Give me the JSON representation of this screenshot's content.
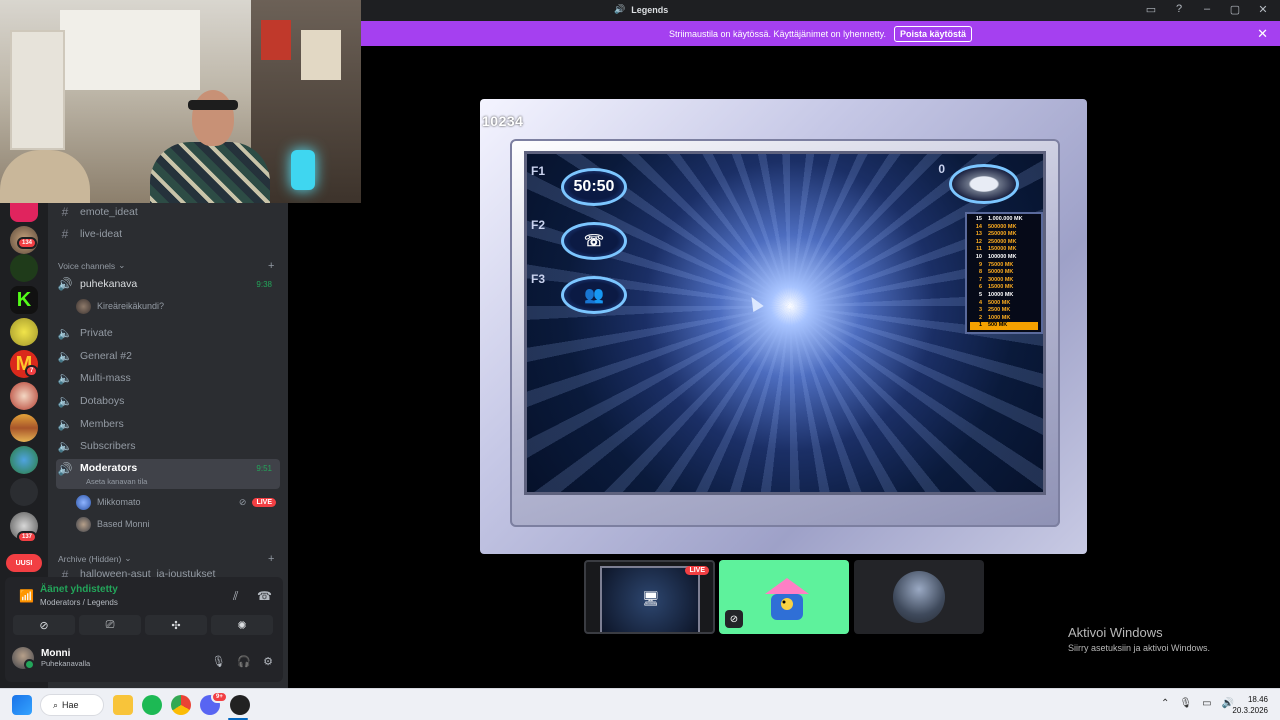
{
  "window": {
    "title": "Legends"
  },
  "banner": {
    "text": "Striimaustila on käytössä. Käyttäjänimet on lyhennetty.",
    "button": "Poista käytöstä"
  },
  "rail": {
    "badges": [
      "134",
      "7",
      "137"
    ],
    "uusi": "UUSI"
  },
  "channels": {
    "text_channels": [
      "emote_ideat",
      "live-ideat"
    ],
    "voice_category": "Voice channels",
    "voice": [
      {
        "name": "puhekanava",
        "time": "9:38"
      },
      {
        "name": "Private"
      },
      {
        "name": "General #2"
      },
      {
        "name": "Multi-mass"
      },
      {
        "name": "Dotaboys"
      },
      {
        "name": "Members"
      },
      {
        "name": "Subscribers"
      },
      {
        "name": "Moderators",
        "time": "9:51",
        "subtitle": "Aseta kanavan tila"
      }
    ],
    "puhekanava_user": "Kireäreikäkundi?",
    "moderators_users": [
      "Mikkomato",
      "Based Monni"
    ],
    "live_label": "LIVE",
    "archive_category": "Archive (Hidden)",
    "archive_partial": "halloween-asut_ja-joustukset"
  },
  "voice_panel": {
    "status": "Äänet yhdistetty",
    "location": "Moderators / Legends",
    "user_name": "Monni",
    "user_status": "Puhekanavalla"
  },
  "game": {
    "score": "10234",
    "lifeline_keys": [
      "F1",
      "F2",
      "F3"
    ],
    "fifty_label": "50:50",
    "question_number": "0",
    "money_ladder": [
      {
        "n": "15",
        "amount": "1.000.000 MK"
      },
      {
        "n": "14",
        "amount": "500000 MK"
      },
      {
        "n": "13",
        "amount": "250000 MK"
      },
      {
        "n": "12",
        "amount": "250000 MK"
      },
      {
        "n": "11",
        "amount": "150000 MK"
      },
      {
        "n": "10",
        "amount": "100000 MK"
      },
      {
        "n": "9",
        "amount": "75000 MK"
      },
      {
        "n": "8",
        "amount": "50000 MK"
      },
      {
        "n": "7",
        "amount": "30000 MK"
      },
      {
        "n": "6",
        "amount": "15000 MK"
      },
      {
        "n": "5",
        "amount": "10000 MK"
      },
      {
        "n": "4",
        "amount": "5000 MK"
      },
      {
        "n": "3",
        "amount": "2500 MK"
      },
      {
        "n": "2",
        "amount": "1000 MK"
      },
      {
        "n": "1",
        "amount": "500 MK"
      }
    ]
  },
  "tiles": {
    "live_label": "LIVE"
  },
  "activate": {
    "title": "Aktivoi Windows",
    "subtitle": "Siirry asetuksiin ja aktivoi Windows."
  },
  "taskbar": {
    "search": "Hae",
    "discord_badge": "9+",
    "time": "18.46",
    "date": "20.3.2026"
  },
  "colors": {
    "discord_bg": "#2b2d31",
    "banner": "#a540f0",
    "voice_green": "#23a55a",
    "live_red": "#f23f43"
  }
}
